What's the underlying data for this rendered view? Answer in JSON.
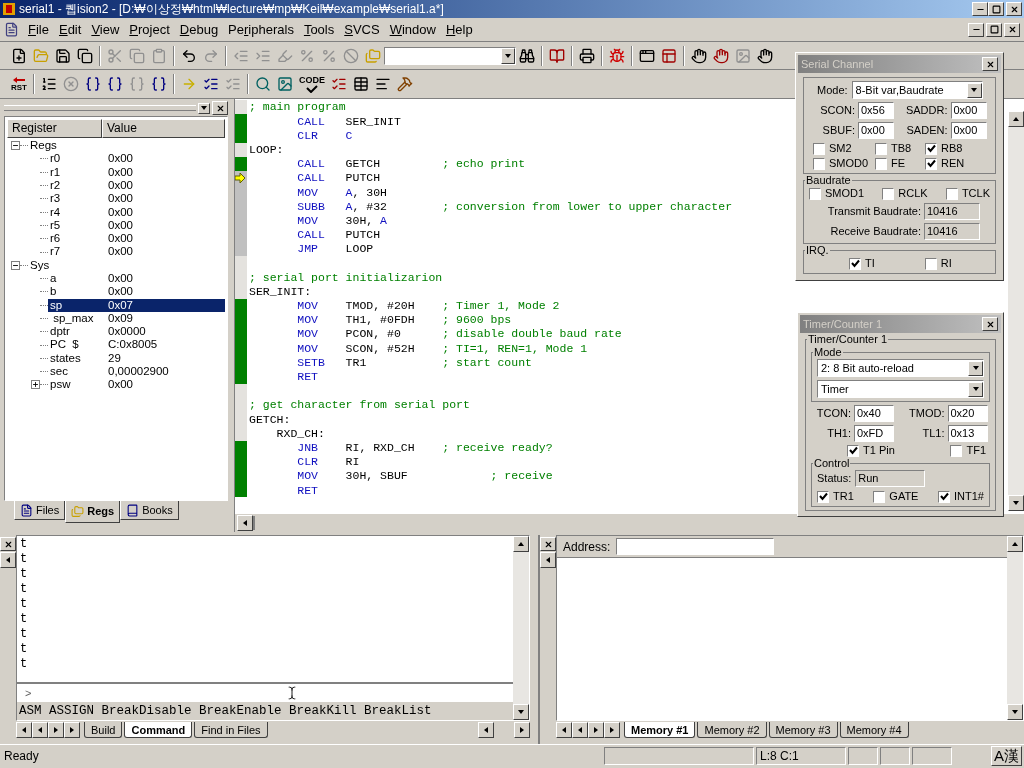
{
  "title_bar": {
    "title": "serial1  - 퀩ision2 - [D:₩이상정₩html₩lecture₩mp₩Keil₩example₩serial1.a*]",
    "active": true
  },
  "menu": [
    {
      "key": "F",
      "post": "ile"
    },
    {
      "key": "E",
      "post": "dit"
    },
    {
      "key": "V",
      "post": "iew"
    },
    {
      "key": "P",
      "post": "roject"
    },
    {
      "key": "D",
      "post": "ebug"
    },
    {
      "pre": "Pe",
      "key": "r",
      "post": "ipherals"
    },
    {
      "key": "T",
      "post": "ools"
    },
    {
      "key": "S",
      "post": "VCS"
    },
    {
      "key": "W",
      "post": "indow"
    },
    {
      "key": "H",
      "post": "elp"
    }
  ],
  "debug_toolbar": {
    "reset_label": "RST",
    "code_label": "CODE"
  },
  "registers": {
    "columns": [
      "Register",
      "Value"
    ],
    "groups": [
      {
        "name": "Regs",
        "expanded": true,
        "children": [
          {
            "name": "r0",
            "value": "0x00",
            "selected": false
          },
          {
            "name": "r1",
            "value": "0x00",
            "selected": false
          },
          {
            "name": "r2",
            "value": "0x00",
            "selected": false
          },
          {
            "name": "r3",
            "value": "0x00",
            "selected": false
          },
          {
            "name": "r4",
            "value": "0x00",
            "selected": false
          },
          {
            "name": "r5",
            "value": "0x00",
            "selected": false
          },
          {
            "name": "r6",
            "value": "0x00",
            "selected": false
          },
          {
            "name": "r7",
            "value": "0x00",
            "selected": false
          }
        ]
      },
      {
        "name": "Sys",
        "expanded": true,
        "children": [
          {
            "name": "a",
            "value": "0x00",
            "selected": false
          },
          {
            "name": "b",
            "value": "0x00",
            "selected": false
          },
          {
            "name": "sp",
            "value": "0x07",
            "selected": true
          },
          {
            "name": " sp_max",
            "value": "0x09",
            "selected": false
          },
          {
            "name": "dptr",
            "value": "0x0000",
            "selected": false
          },
          {
            "name": "PC  $",
            "value": "C:0x8005",
            "selected": false
          },
          {
            "name": "states",
            "value": "29",
            "selected": false
          },
          {
            "name": "sec",
            "value": "0,00002900",
            "selected": false
          },
          {
            "name": "psw",
            "value": "0x00",
            "selected": false,
            "expanded": false
          }
        ]
      }
    ]
  },
  "project_tabs": [
    {
      "label": "Files",
      "selected": false
    },
    {
      "label": "Regs",
      "selected": true
    },
    {
      "label": "Books",
      "selected": false
    }
  ],
  "editor": {
    "lines": [
      {
        "kind": "comment",
        "text": "; main program",
        "has_code": false,
        "current": false
      },
      {
        "kind": "instr",
        "mnemonic": "CALL",
        "operand": [
          {
            "text": "SER_INIT",
            "reg": false
          }
        ],
        "has_code": true,
        "executed": true,
        "current": false
      },
      {
        "kind": "instr",
        "mnemonic": "CLR",
        "operand": [
          {
            "text": "C",
            "reg": true
          }
        ],
        "has_code": true,
        "executed": true,
        "current": false
      },
      {
        "kind": "label",
        "text": "LOOP:",
        "nested": false,
        "has_code": false,
        "current": false
      },
      {
        "kind": "instr",
        "mnemonic": "CALL",
        "operand": [
          {
            "text": "GETCH",
            "reg": false
          }
        ],
        "comment": "; echo print",
        "has_code": true,
        "executed": true,
        "current": false
      },
      {
        "kind": "instr",
        "mnemonic": "CALL",
        "operand": [
          {
            "text": "PUTCH",
            "reg": false
          }
        ],
        "has_code": true,
        "executed": false,
        "current": true
      },
      {
        "kind": "instr",
        "mnemonic": "MOV",
        "operand": [
          {
            "text": "A",
            "reg": true
          },
          {
            "text": ", 30H",
            "reg": false
          }
        ],
        "has_code": true,
        "executed": false,
        "current": false
      },
      {
        "kind": "instr",
        "mnemonic": "SUBB",
        "operand": [
          {
            "text": "A",
            "reg": true
          },
          {
            "text": ", #32",
            "reg": false
          }
        ],
        "comment": "; conversion from lower to upper character",
        "has_code": true,
        "executed": false,
        "current": false
      },
      {
        "kind": "instr",
        "mnemonic": "MOV",
        "operand": [
          {
            "text": "30H, ",
            "reg": false
          },
          {
            "text": "A",
            "reg": true
          }
        ],
        "has_code": true,
        "executed": false,
        "current": false
      },
      {
        "kind": "instr",
        "mnemonic": "CALL",
        "operand": [
          {
            "text": "PUTCH",
            "reg": false
          }
        ],
        "has_code": true,
        "executed": false,
        "current": false
      },
      {
        "kind": "instr",
        "mnemonic": "JMP",
        "operand": [
          {
            "text": "LOOP",
            "reg": false
          }
        ],
        "has_code": true,
        "executed": false,
        "current": false
      },
      {
        "kind": "blank",
        "has_code": false,
        "current": false
      },
      {
        "kind": "comment",
        "text": "; serial port initializarion",
        "has_code": false,
        "current": false
      },
      {
        "kind": "label",
        "text": "SER_INIT:",
        "nested": false,
        "has_code": false,
        "current": false
      },
      {
        "kind": "instr",
        "mnemonic": "MOV",
        "operand": [
          {
            "text": "TMOD, #20H",
            "reg": false
          }
        ],
        "comment": "; Timer 1, Mode 2",
        "has_code": true,
        "executed": true,
        "current": false
      },
      {
        "kind": "instr",
        "mnemonic": "MOV",
        "operand": [
          {
            "text": "TH1, #0FDH",
            "reg": false
          }
        ],
        "comment": "; 9600 bps",
        "has_code": true,
        "executed": true,
        "current": false
      },
      {
        "kind": "instr",
        "mnemonic": "MOV",
        "operand": [
          {
            "text": "PCON, #0",
            "reg": false
          }
        ],
        "comment": "; disable double baud rate",
        "has_code": true,
        "executed": true,
        "current": false
      },
      {
        "kind": "instr",
        "mnemonic": "MOV",
        "operand": [
          {
            "text": "SCON, #52H",
            "reg": false
          }
        ],
        "comment": "; TI=1, REN=1, Mode 1",
        "has_code": true,
        "executed": true,
        "current": false
      },
      {
        "kind": "instr",
        "mnemonic": "SETB",
        "operand": [
          {
            "text": "TR1",
            "reg": false
          }
        ],
        "comment": "; start count",
        "has_code": true,
        "executed": true,
        "current": false
      },
      {
        "kind": "instr",
        "mnemonic": "RET",
        "has_code": true,
        "executed": true,
        "current": false
      },
      {
        "kind": "blank",
        "has_code": false,
        "current": false
      },
      {
        "kind": "comment",
        "text": "; get character from serial port",
        "has_code": false,
        "current": false
      },
      {
        "kind": "label",
        "text": "GETCH:",
        "nested": false,
        "has_code": false,
        "current": false
      },
      {
        "kind": "label",
        "text": "RXD_CH:",
        "nested": true,
        "has_code": false,
        "current": false
      },
      {
        "kind": "instr",
        "mnemonic": "JNB",
        "operand": [
          {
            "text": "RI, RXD_CH",
            "reg": false
          }
        ],
        "comment": "; receive ready?",
        "has_code": true,
        "executed": true,
        "current": false
      },
      {
        "kind": "instr",
        "mnemonic": "CLR",
        "operand": [
          {
            "text": "RI",
            "reg": false
          }
        ],
        "has_code": true,
        "executed": true,
        "current": false
      },
      {
        "kind": "instr",
        "mnemonic": "MOV",
        "operand": [
          {
            "text": "30H, SBUF",
            "reg": false
          }
        ],
        "comment": "; receive",
        "comment_far": true,
        "has_code": true,
        "executed": true,
        "current": false
      },
      {
        "kind": "instr",
        "mnemonic": "RET",
        "has_code": true,
        "executed": true,
        "current": false
      }
    ]
  },
  "serial_channel": {
    "title": "Serial Channel",
    "active": false,
    "mode_label": "Mode:",
    "mode": "8-Bit var,Baudrate",
    "fields": [
      {
        "label": "SCON:",
        "value": "0x56"
      },
      {
        "label": "SADDR:",
        "value": "0x00"
      },
      {
        "label": "SBUF:",
        "value": "0x00"
      },
      {
        "label": "SADEN:",
        "value": "0x00"
      }
    ],
    "flags": [
      {
        "label": "SM2",
        "checked": false
      },
      {
        "label": "TB8",
        "checked": false
      },
      {
        "label": "RB8",
        "checked": true
      },
      {
        "label": "SMOD0",
        "checked": false
      },
      {
        "label": "FE",
        "checked": false
      },
      {
        "label": "REN",
        "checked": true
      }
    ],
    "baudrate": {
      "title": "Baudrate",
      "flags": [
        {
          "label": "SMOD1",
          "checked": false
        },
        {
          "label": "RCLK",
          "checked": false
        },
        {
          "label": "TCLK",
          "checked": false
        }
      ],
      "readouts": [
        {
          "label": "Transmit Baudrate:",
          "value": "10416"
        },
        {
          "label": "Receive Baudrate:",
          "value": "10416"
        }
      ]
    },
    "irq": {
      "title": "IRQ.",
      "flags": [
        {
          "label": "TI",
          "checked": true
        },
        {
          "label": "RI",
          "checked": false
        }
      ]
    }
  },
  "timer_counter": {
    "title": "Timer/Counter 1",
    "active": false,
    "group_title": "Timer/Counter 1",
    "mode_title": "Mode",
    "mode_selects": [
      "2: 8 Bit auto-reload",
      "Timer"
    ],
    "fields": [
      {
        "label": "TCON:",
        "value": "0x40"
      },
      {
        "label": "TMOD:",
        "value": "0x20"
      },
      {
        "label": "TH1:",
        "value": "0xFD"
      },
      {
        "label": "TL1:",
        "value": "0x13"
      }
    ],
    "flags": [
      {
        "label": "T1 Pin",
        "checked": true
      },
      {
        "label": "TF1",
        "checked": false
      }
    ],
    "control": {
      "title": "Control",
      "status_label": "Status:",
      "status": "Run",
      "flags": [
        {
          "label": "TR1",
          "checked": true
        },
        {
          "label": "GATE",
          "checked": false
        },
        {
          "label": "INT1#",
          "checked": true
        }
      ]
    }
  },
  "output": {
    "lines": [
      "t",
      "t",
      "t",
      "t",
      "t",
      "t",
      "t",
      "t",
      "t"
    ],
    "prompt": ">",
    "command_hint": "ASM ASSIGN BreakDisable BreakEnable BreakKill BreakList",
    "tabs": [
      {
        "label": "Build",
        "selected": false
      },
      {
        "label": "Command",
        "selected": true
      },
      {
        "label": "Find in Files",
        "selected": false
      }
    ]
  },
  "memory": {
    "address_label": "Address:",
    "tabs": [
      {
        "label": "Memory #1",
        "selected": true
      },
      {
        "label": "Memory #2",
        "selected": false
      },
      {
        "label": "Memory #3",
        "selected": false
      },
      {
        "label": "Memory #4",
        "selected": false
      }
    ]
  },
  "status_bar": {
    "text": "Ready",
    "position": "L:8 C:1",
    "ime": "A漢"
  }
}
